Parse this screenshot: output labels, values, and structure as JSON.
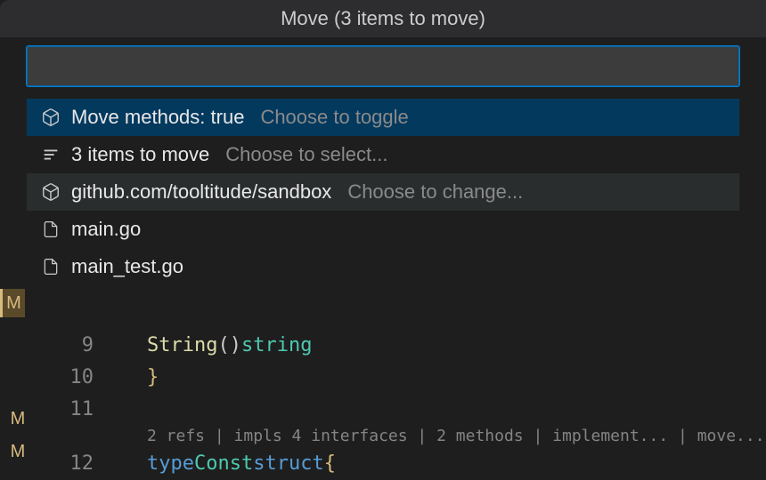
{
  "window": {
    "title": "Move (3 items to move)"
  },
  "picker": {
    "search_value": "",
    "items": [
      {
        "label": "Move methods: true",
        "hint": "Choose to toggle",
        "icon": "package-icon"
      },
      {
        "label": "3 items to move",
        "hint": "Choose to select...",
        "icon": "list-icon"
      },
      {
        "label": "github.com/tooltitude/sandbox",
        "hint": "Choose to change...",
        "icon": "package-icon"
      },
      {
        "label": "main.go",
        "hint": "",
        "icon": "file-icon"
      },
      {
        "label": "main_test.go",
        "hint": "",
        "icon": "file-icon"
      }
    ]
  },
  "sidebar": {
    "markers": [
      "M",
      "M",
      "M"
    ]
  },
  "editor": {
    "lines": [
      {
        "number": "9",
        "tokens": [
          {
            "text": "    ",
            "class": ""
          },
          {
            "text": "String",
            "class": "tok-func"
          },
          {
            "text": "() ",
            "class": ""
          },
          {
            "text": "string",
            "class": "tok-type"
          }
        ]
      },
      {
        "number": "10",
        "tokens": [
          {
            "text": "}",
            "class": "tok-brace"
          }
        ]
      },
      {
        "number": "11",
        "tokens": []
      },
      {
        "number": "12",
        "tokens": [
          {
            "text": "type ",
            "class": "tok-keyword"
          },
          {
            "text": "Const ",
            "class": "tok-struct"
          },
          {
            "text": "struct ",
            "class": "tok-keyword"
          },
          {
            "text": "{",
            "class": "tok-brace"
          }
        ]
      }
    ],
    "codelens": "2 refs | impls 4 interfaces | 2 methods | implement... | move..."
  }
}
